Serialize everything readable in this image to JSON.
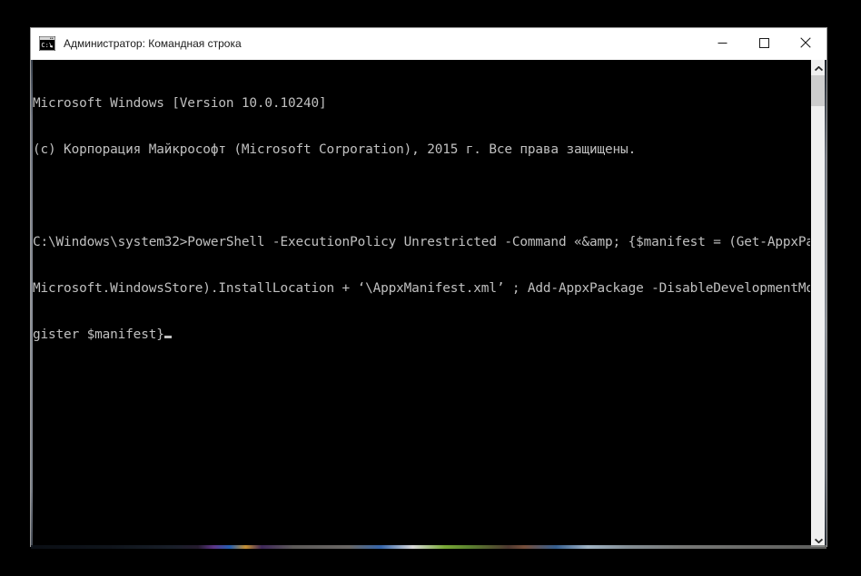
{
  "window": {
    "title": "Администратор: Командная строка",
    "icon": "cmd-console-icon",
    "controls": {
      "minimize_label": "Свернуть",
      "maximize_label": "Развернуть",
      "close_label": "Закрыть"
    },
    "titlebar_bg": "#ffffff",
    "titlebar_fg": "#1a1a1a"
  },
  "console": {
    "background": "#000000",
    "foreground": "#c0c0c0",
    "lines": [
      "Microsoft Windows [Version 10.0.10240]",
      "(c) Корпорация Майкрософт (Microsoft Corporation), 2015 г. Все права защищены.",
      "",
      "C:\\Windows\\system32>PowerShell -ExecutionPolicy Unrestricted -Command «&amp; {$manifest = (Get-AppxPackage",
      "Microsoft.WindowsStore).InstallLocation + ‘\\AppxManifest.xml’ ; Add-AppxPackage -DisableDevelopmentMode -Re",
      "gister $manifest}"
    ],
    "prompt_path": "C:\\Windows\\system32>",
    "cursor_visible": true
  },
  "scrollbar": {
    "up_arrow": "chevron-up-icon",
    "down_arrow": "chevron-down-icon",
    "thumb_position_percent": 0,
    "track_color": "#f0f0f0",
    "thumb_color": "#cdcdcd"
  }
}
